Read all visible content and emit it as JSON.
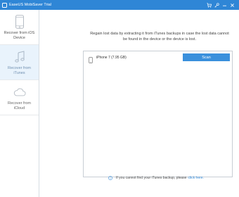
{
  "window": {
    "title": "EaseUS MobiSaver Trial"
  },
  "sidebar": {
    "items": [
      {
        "label_line1": "Recover from iOS",
        "label_line2": "Device",
        "icon": "phone-icon"
      },
      {
        "label_line1": "Recover from",
        "label_line2": "iTunes",
        "icon": "music-note-icon"
      },
      {
        "label_line1": "Recover from",
        "label_line2": "iCloud",
        "icon": "cloud-icon"
      }
    ]
  },
  "main": {
    "description_line1": "Regain lost data by extracting it from iTunes backups in case the lost data cannot",
    "description_line2": "be found in the device or the device is lost.",
    "device": {
      "name": "iPhone 7 (7.95 GB)"
    },
    "scan_label": "Scan",
    "footer_text": "If you cannot find your iTunes backup, please",
    "footer_link": "click here."
  },
  "colors": {
    "accent": "#2f86d6",
    "button": "#3a90dc",
    "active_item": "#e9f3fc"
  }
}
